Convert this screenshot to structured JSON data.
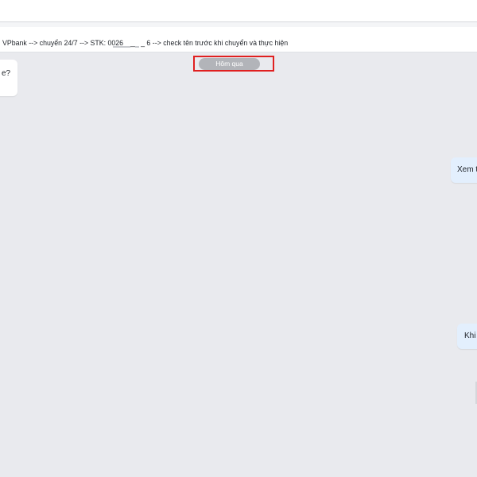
{
  "pinned_message": {
    "text": "VPbank --> chuyển 24/7 --> STK: 0026____ _ 6 --> check tên trước khi chuyển và thực hiện"
  },
  "date_separator": {
    "label": "Hôm qua"
  },
  "messages": [
    {
      "side": "left",
      "text": "e?"
    },
    {
      "side": "right",
      "text": "Xem t"
    },
    {
      "side": "right",
      "text": "Khi"
    }
  ]
}
